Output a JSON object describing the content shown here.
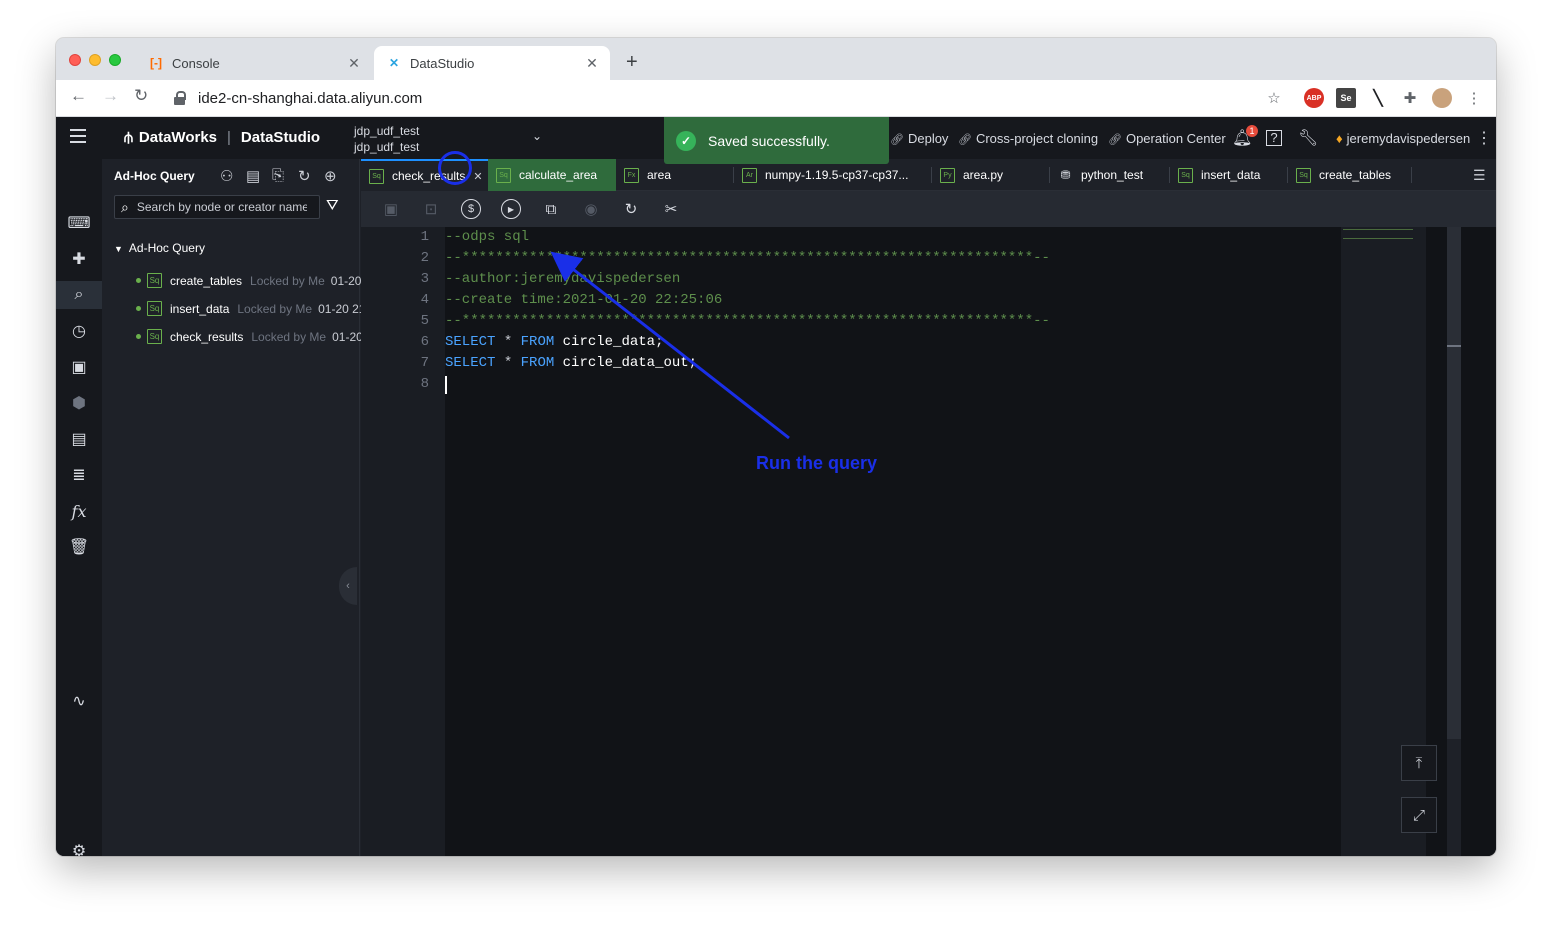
{
  "browser": {
    "tabs": [
      {
        "title": "Console",
        "favicon": "aliyun-console-icon",
        "active": false
      },
      {
        "title": "DataStudio",
        "favicon": "datastudio-icon",
        "active": true
      }
    ],
    "url": "ide2-cn-shanghai.data.aliyun.com"
  },
  "app": {
    "brand": "DataWorks",
    "product": "DataStudio",
    "workspace_line1": "jdp_udf_test",
    "workspace_line2": "jdp_udf_test",
    "toast": "Saved successfully.",
    "links": {
      "deploy": "Deploy",
      "cross_project": "Cross-project cloning",
      "operation_center": "Operation Center"
    },
    "notification_count": "1",
    "username": "jeremydavispedersen"
  },
  "panel": {
    "title": "Ad-Hoc Query",
    "search_placeholder": "Search by node or creator name.",
    "tree_root": "Ad-Hoc Query",
    "nodes": [
      {
        "name": "create_tables",
        "lock": "Locked by Me",
        "date": "01-20"
      },
      {
        "name": "insert_data",
        "lock": "Locked by Me",
        "date": "01-20 21"
      },
      {
        "name": "check_results",
        "lock": "Locked by Me",
        "date": "01-20"
      }
    ]
  },
  "editor": {
    "tabs": [
      {
        "label": "check_results",
        "type": "Sq"
      },
      {
        "label": "calculate_area",
        "type": "Sq"
      },
      {
        "label": "area",
        "type": "Fx"
      },
      {
        "label": "numpy-1.19.5-cp37-cp37...",
        "type": "Ar"
      },
      {
        "label": "area.py",
        "type": "Py"
      },
      {
        "label": "python_test",
        "type": "flow"
      },
      {
        "label": "insert_data",
        "type": "Sq"
      },
      {
        "label": "create_tables",
        "type": "Sq"
      }
    ],
    "line_numbers": [
      "1",
      "2",
      "3",
      "4",
      "5",
      "6",
      "7",
      "8"
    ],
    "lines": {
      "l1": "--odps sql",
      "l2": "--********************************************************************--",
      "l3": "--author:jeremydavispedersen",
      "l4": "--create time:2021-01-20 22:25:06",
      "l5": "--********************************************************************--",
      "l6_kw1": "SELECT",
      "l6_op": " * ",
      "l6_kw2": "FROM",
      "l6_id": " circle_data;",
      "l7_kw1": "SELECT",
      "l7_op": " * ",
      "l7_kw2": "FROM",
      "l7_id": " circle_data_out;"
    }
  },
  "annotation": {
    "label": "Run the query",
    "color": "#1a2fe8"
  },
  "colors": {
    "accent_blue": "#1e90ff",
    "success_green": "#2f6b3c",
    "comment_green": "#5e8f4c",
    "keyword_blue": "#4aa3ff"
  }
}
